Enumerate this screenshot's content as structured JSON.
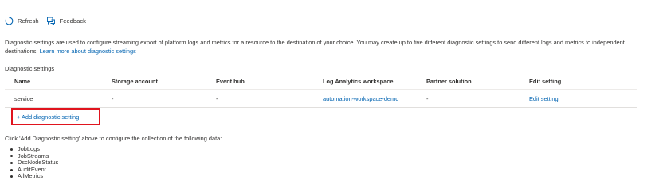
{
  "toolbar": {
    "refresh_label": "Refresh",
    "feedback_label": "Feedback"
  },
  "description": {
    "text": "Diagnostic settings are used to configure streaming export of platform logs and metrics for a resource to the destination of your choice. You may create up to five different diagnostic settings to send different logs and metrics to independent destinations.",
    "link": "Learn more about diagnostic settings"
  },
  "section_title": "Diagnostic settings",
  "table": {
    "headers": {
      "name": "Name",
      "storage": "Storage account",
      "eventhub": "Event hub",
      "workspace": "Log Analytics workspace",
      "partner": "Partner solution",
      "edit": "Edit setting"
    },
    "rows": [
      {
        "name": "service",
        "storage": "-",
        "eventhub": "-",
        "workspace": "automation-workspace-demo",
        "partner": "-",
        "edit": "Edit setting"
      }
    ]
  },
  "add_setting_label": "+ Add diagnostic setting",
  "hint": "Click 'Add Diagnostic setting' above to configure the collection of the following data:",
  "data_items": [
    "JobLogs",
    "JobStreams",
    "DscNodeStatus",
    "AuditEvent",
    "AllMetrics"
  ],
  "colors": {
    "link": "#0063b1",
    "highlight_border": "#e0141e",
    "text": "#323130"
  },
  "icons": {
    "refresh": "refresh-icon",
    "feedback": "feedback-icon"
  }
}
